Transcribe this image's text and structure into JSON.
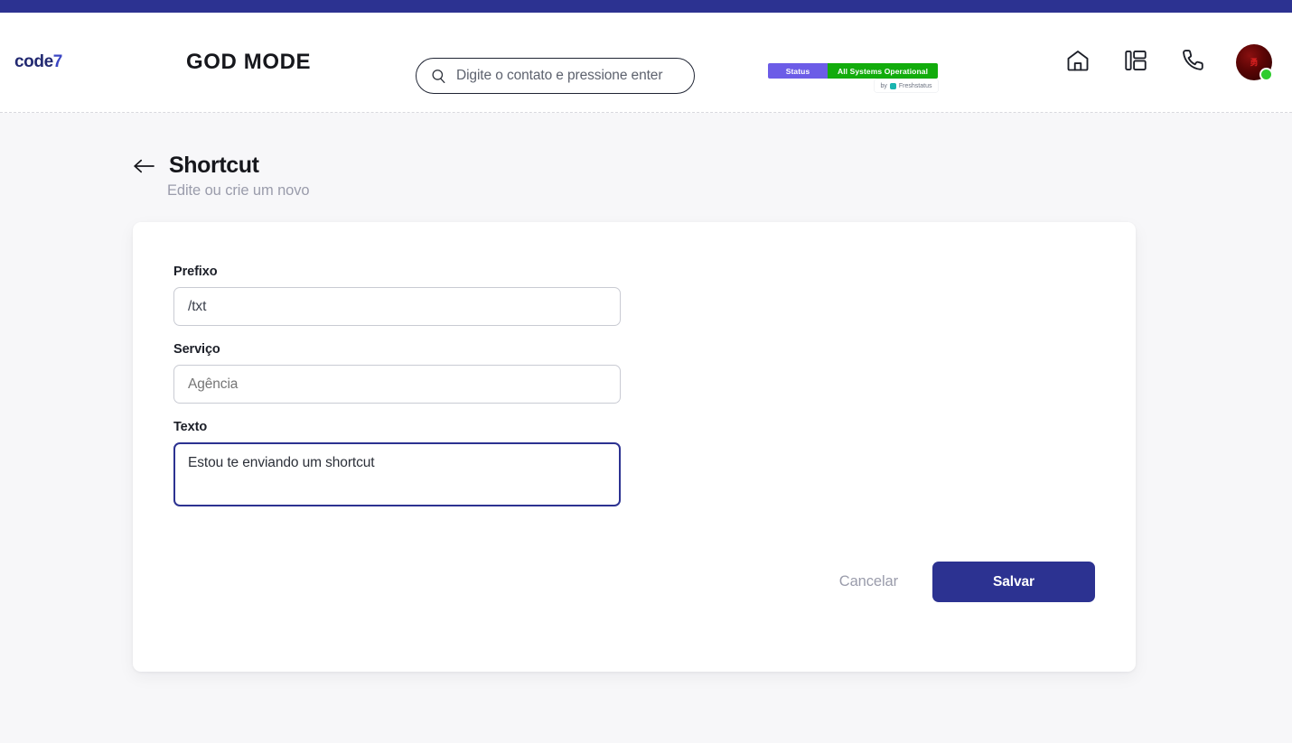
{
  "brand": {
    "name": "code",
    "accent": "7",
    "color": "#232a72"
  },
  "header": {
    "app_title": "GOD MODE",
    "search": {
      "placeholder": "Digite o contato e pressione enter",
      "value": "",
      "icon": "search-icon"
    },
    "status_widget": {
      "left_label": "Status",
      "right_label": "All Systems Operational",
      "attribution_prefix": "by",
      "attribution_brand": "Freshstatus",
      "left_color": "#6c5ce7",
      "right_color": "#12ac0c",
      "attribution_icon_color": "#19b5b0"
    },
    "icons": [
      {
        "name": "home-icon",
        "label": "Home"
      },
      {
        "name": "layout-icon",
        "label": "Layout"
      },
      {
        "name": "phone-icon",
        "label": "Telefone"
      }
    ],
    "avatar": {
      "name": "user-avatar",
      "initials": "勇",
      "status": "online",
      "status_color": "#2ecc2e"
    }
  },
  "page": {
    "back_icon": "arrow-left-icon",
    "title": "Shortcut",
    "subtitle": "Edite ou crie um novo"
  },
  "form": {
    "fields": [
      {
        "label": "Prefixo",
        "value": "/txt",
        "placeholder": "",
        "type": "text",
        "focused": false
      },
      {
        "label": "Serviço",
        "value": "Agência",
        "placeholder": "Agência",
        "type": "text",
        "focused": false
      },
      {
        "label": "Texto",
        "value": "Estou te enviando um shortcut",
        "placeholder": "",
        "type": "textarea",
        "focused": true
      }
    ]
  },
  "actions": {
    "cancel_label": "Cancelar",
    "save_label": "Salvar",
    "save_color": "#2c3291"
  },
  "theme": {
    "navy": "#2c3291",
    "page_bg": "#f7f7f9",
    "card_bg": "#ffffff"
  }
}
